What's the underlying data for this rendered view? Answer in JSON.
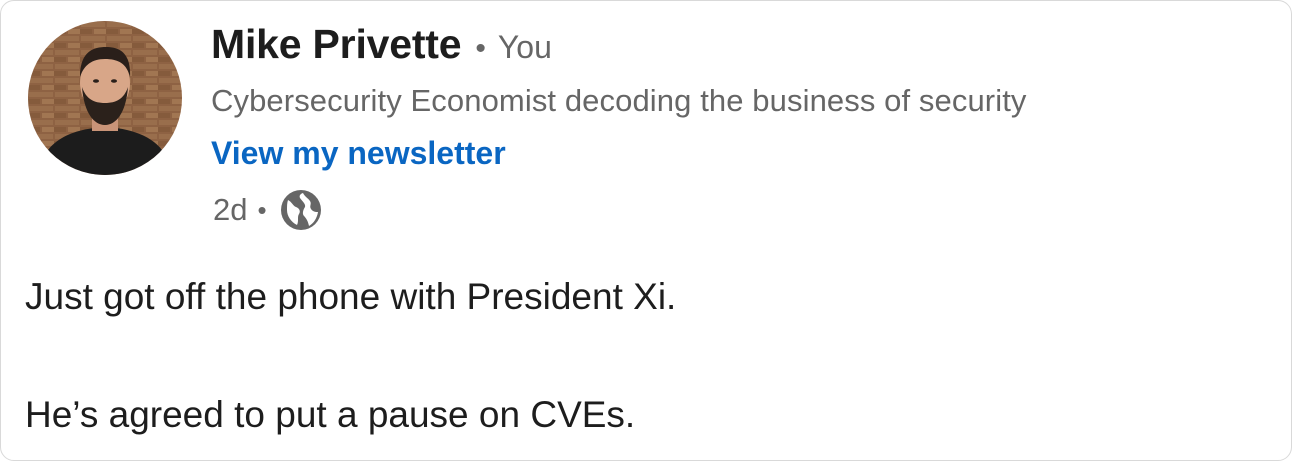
{
  "post": {
    "author": {
      "name": "Mike Privette",
      "relation": "You",
      "headline": "Cybersecurity Economist decoding the business of security",
      "newsletter_link": "View my newsletter"
    },
    "meta": {
      "time": "2d",
      "visibility_icon": "globe-icon"
    },
    "body": {
      "line1": "Just got off the phone with President Xi.",
      "line2": "He’s agreed to put a pause on CVEs."
    }
  },
  "colors": {
    "name": "#1d1d1d",
    "secondary": "#666666",
    "link": "#0a66c2"
  }
}
